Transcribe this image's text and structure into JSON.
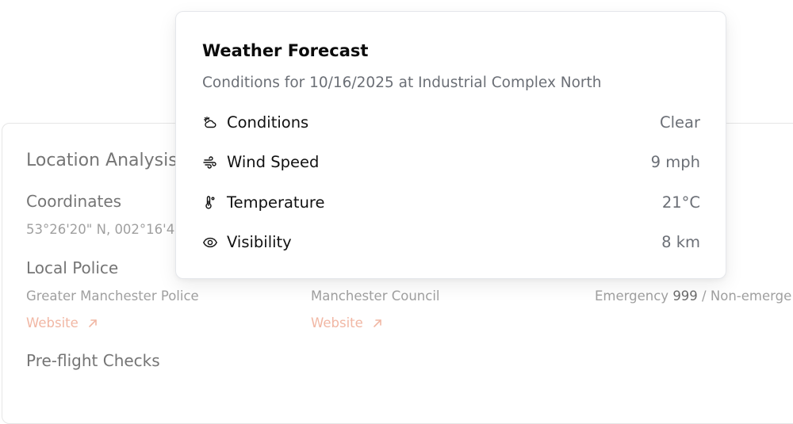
{
  "background": {
    "section_title": "Location Analysis",
    "coordinates": {
      "heading": "Coordinates",
      "value": "53°26'20\" N, 002°16'43\" W"
    },
    "local_police": {
      "heading": "Local Police",
      "columns": [
        {
          "name": "Greater Manchester Police",
          "link_label": "Website"
        },
        {
          "name": "Manchester Council",
          "link_label": "Website"
        }
      ],
      "emergency": {
        "prefix": "Emergency",
        "number": "999",
        "separator": " / ",
        "suffix": "Non-emerge"
      }
    },
    "preflight": {
      "heading": "Pre-flight Checks"
    }
  },
  "popover": {
    "title": "Weather Forecast",
    "subtitle": "Conditions for 10/16/2025 at Industrial Complex North",
    "rows": [
      {
        "icon": "cloud-sun-icon",
        "label": "Conditions",
        "value": "Clear"
      },
      {
        "icon": "wind-icon",
        "label": "Wind Speed",
        "value": "9 mph"
      },
      {
        "icon": "thermometer-icon",
        "label": "Temperature",
        "value": "21°C"
      },
      {
        "icon": "eye-icon",
        "label": "Visibility",
        "value": "8 km"
      }
    ]
  },
  "colors": {
    "link": "#f1b7a4",
    "muted": "#6b6f76",
    "border": "#e5e7eb"
  }
}
